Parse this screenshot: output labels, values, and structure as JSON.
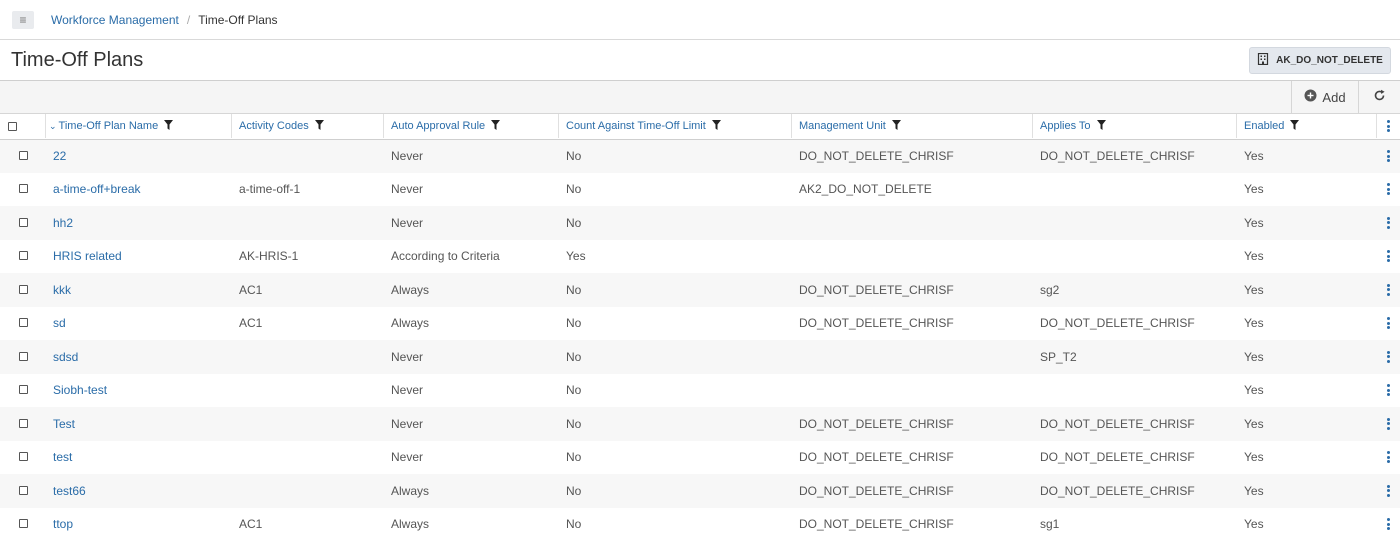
{
  "breadcrumb": {
    "parent": "Workforce Management",
    "separator": "/",
    "current": "Time-Off Plans"
  },
  "page": {
    "title": "Time-Off Plans",
    "unit_button": "AK_DO_NOT_DELETE"
  },
  "toolbar": {
    "add_label": "Add"
  },
  "table": {
    "columns": [
      "Time-Off Plan Name",
      "Activity Codes",
      "Auto Approval Rule",
      "Count Against Time-Off Limit",
      "Management Unit",
      "Applies To",
      "Enabled"
    ],
    "rows": [
      {
        "name": "22",
        "codes": "",
        "rule": "Never",
        "count": "No",
        "mu": "DO_NOT_DELETE_CHRISF",
        "applies": "DO_NOT_DELETE_CHRISF",
        "enabled": "Yes"
      },
      {
        "name": "a-time-off+break",
        "codes": "a-time-off-1",
        "rule": "Never",
        "count": "No",
        "mu": "AK2_DO_NOT_DELETE",
        "applies": "",
        "enabled": "Yes"
      },
      {
        "name": "hh2",
        "codes": "",
        "rule": "Never",
        "count": "No",
        "mu": "",
        "applies": "",
        "enabled": "Yes"
      },
      {
        "name": "HRIS related",
        "codes": "AK-HRIS-1",
        "rule": "According to Criteria",
        "count": "Yes",
        "mu": "",
        "applies": "",
        "enabled": "Yes"
      },
      {
        "name": "kkk",
        "codes": "AC1",
        "rule": "Always",
        "count": "No",
        "mu": "DO_NOT_DELETE_CHRISF",
        "applies": "sg2",
        "enabled": "Yes"
      },
      {
        "name": "sd",
        "codes": "AC1",
        "rule": "Always",
        "count": "No",
        "mu": "DO_NOT_DELETE_CHRISF",
        "applies": "DO_NOT_DELETE_CHRISF",
        "enabled": "Yes"
      },
      {
        "name": "sdsd",
        "codes": "",
        "rule": "Never",
        "count": "No",
        "mu": "",
        "applies": "SP_T2",
        "enabled": "Yes"
      },
      {
        "name": "Siobh-test",
        "codes": "",
        "rule": "Never",
        "count": "No",
        "mu": "",
        "applies": "",
        "enabled": "Yes"
      },
      {
        "name": "Test",
        "codes": "",
        "rule": "Never",
        "count": "No",
        "mu": "DO_NOT_DELETE_CHRISF",
        "applies": "DO_NOT_DELETE_CHRISF",
        "enabled": "Yes"
      },
      {
        "name": "test",
        "codes": "",
        "rule": "Never",
        "count": "No",
        "mu": "DO_NOT_DELETE_CHRISF",
        "applies": "DO_NOT_DELETE_CHRISF",
        "enabled": "Yes"
      },
      {
        "name": "test66",
        "codes": "",
        "rule": "Always",
        "count": "No",
        "mu": "DO_NOT_DELETE_CHRISF",
        "applies": "DO_NOT_DELETE_CHRISF",
        "enabled": "Yes"
      },
      {
        "name": "ttop",
        "codes": "AC1",
        "rule": "Always",
        "count": "No",
        "mu": "DO_NOT_DELETE_CHRISF",
        "applies": "sg1",
        "enabled": "Yes"
      }
    ]
  }
}
